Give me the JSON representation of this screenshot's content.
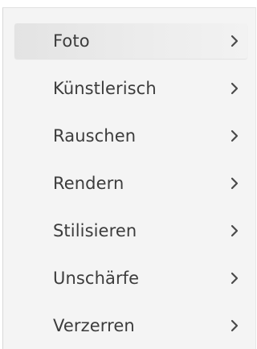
{
  "menu": {
    "items": [
      {
        "label": "Foto",
        "icon": "chevron-right-icon",
        "active": true
      },
      {
        "label": "Künstlerisch",
        "icon": "chevron-right-icon",
        "active": false
      },
      {
        "label": "Rauschen",
        "icon": "chevron-right-icon",
        "active": false
      },
      {
        "label": "Rendern",
        "icon": "chevron-right-icon",
        "active": false
      },
      {
        "label": "Stilisieren",
        "icon": "chevron-right-icon",
        "active": false
      },
      {
        "label": "Unschärfe",
        "icon": "chevron-right-icon",
        "active": false
      },
      {
        "label": "Verzerren",
        "icon": "chevron-right-icon",
        "active": false
      }
    ]
  },
  "colors": {
    "text": "#3c3c3c",
    "menu_background": "#f4f4f4",
    "active_item_background": "#e6e6e6"
  }
}
